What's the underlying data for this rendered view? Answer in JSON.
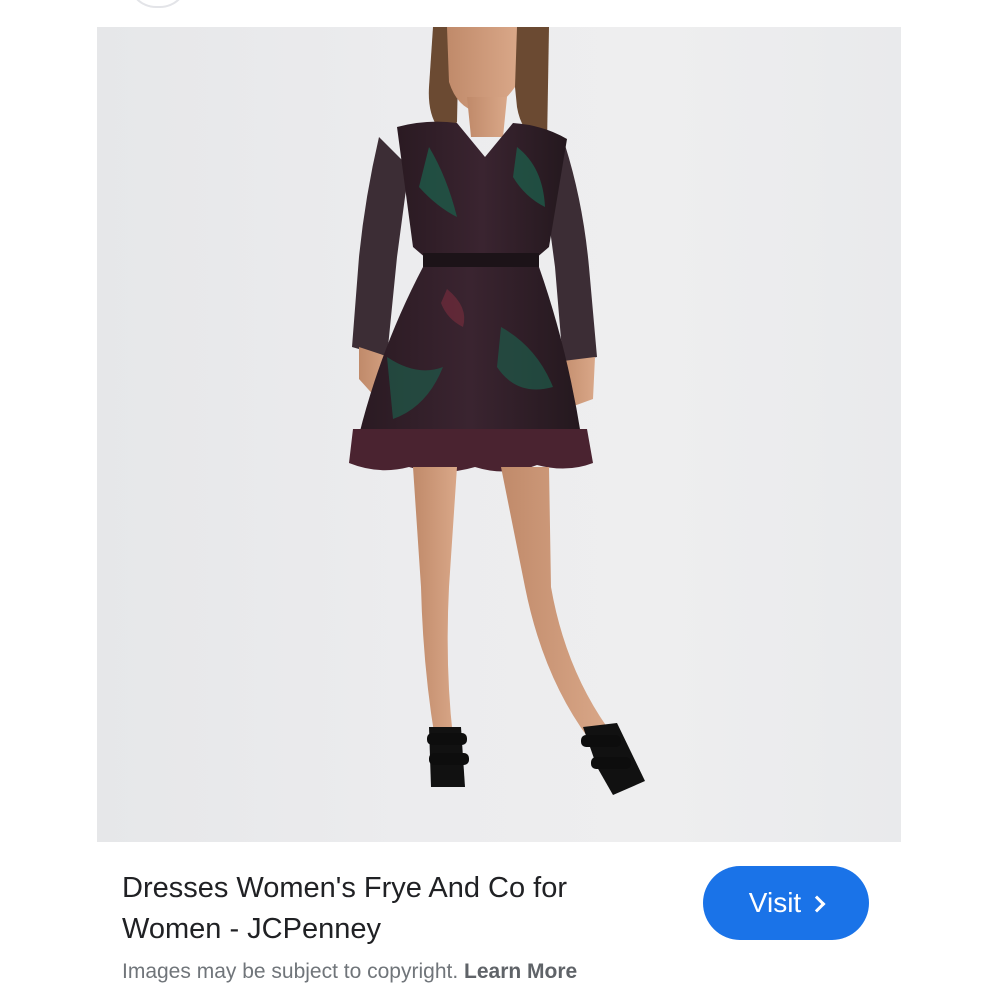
{
  "result": {
    "title": "Dresses Women's Frye And Co for Women - JCPenney",
    "title_line1": "Dresses Women's Frye And Co for",
    "title_line2": "Women - JCPenney",
    "visit_label": "Visit",
    "copyright_text": "Images may be subject to copyright.",
    "learn_more_label": "Learn More"
  },
  "image": {
    "subject": "model wearing dark floral long-sleeve mini dress with ruffle hem and black sandals"
  },
  "icons": {
    "visit_chevron": "chevron-right-icon"
  },
  "colors": {
    "accent": "#1a73e8",
    "title_text": "#202124",
    "muted_text": "#70757a",
    "image_background": "#ececee"
  }
}
